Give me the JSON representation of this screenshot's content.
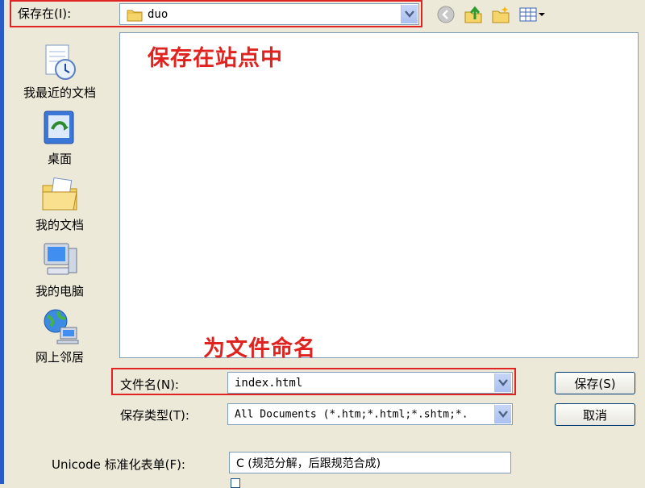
{
  "save_in": {
    "label": "保存在(I):",
    "value": "duo"
  },
  "places": [
    {
      "label": "我最近的文档",
      "icon": "recent-documents-icon"
    },
    {
      "label": "桌面",
      "icon": "desktop-icon"
    },
    {
      "label": "我的文档",
      "icon": "my-documents-icon"
    },
    {
      "label": "我的电脑",
      "icon": "my-computer-icon"
    },
    {
      "label": "网上邻居",
      "icon": "network-places-icon"
    }
  ],
  "annotations": {
    "save_in_site": "保存在站点中",
    "name_file": "为文件命名"
  },
  "file_name": {
    "label": "文件名(N):",
    "value": "index.html"
  },
  "save_type": {
    "label": "保存类型(T):",
    "value": "All Documents (*.htm;*.html;*.shtm;*."
  },
  "unicode_form": {
    "label": "Unicode 标准化表单(F):",
    "value": "C (规范分解，后跟规范合成)"
  },
  "buttons": {
    "save": "保存(S)",
    "cancel": "取消"
  },
  "colors": {
    "annotation_red": "#e0231e",
    "dialog_bg": "#ece9d8",
    "xp_blue": "#2a5cc8"
  }
}
